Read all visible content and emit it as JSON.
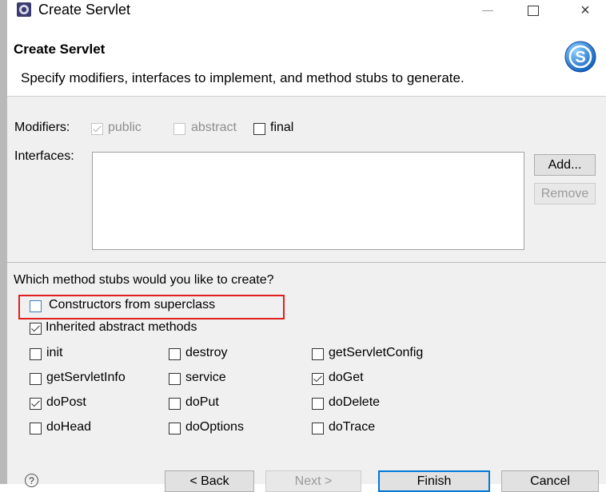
{
  "window": {
    "title": "Create Servlet",
    "close_glyph": "×"
  },
  "header": {
    "title": "Create Servlet",
    "description": "Specify modifiers, interfaces to implement, and method stubs to generate.",
    "logo_letter": "S"
  },
  "modifiers": {
    "label": "Modifiers:",
    "public": {
      "label": "public",
      "checked": true,
      "enabled": false
    },
    "abstract": {
      "label": "abstract",
      "checked": false,
      "enabled": false
    },
    "final": {
      "label": "final",
      "checked": false,
      "enabled": true
    }
  },
  "interfaces": {
    "label": "Interfaces:",
    "add_label": "Add...",
    "remove_label": "Remove"
  },
  "stubs": {
    "question": "Which method stubs would you like to create?",
    "constructors": {
      "label": "Constructors from superclass",
      "checked": false
    },
    "inherited": {
      "label": "Inherited abstract methods",
      "checked": true
    },
    "methods": [
      {
        "label": "init",
        "checked": false
      },
      {
        "label": "destroy",
        "checked": false
      },
      {
        "label": "getServletConfig",
        "checked": false
      },
      {
        "label": "getServletInfo",
        "checked": false
      },
      {
        "label": "service",
        "checked": false
      },
      {
        "label": "doGet",
        "checked": true
      },
      {
        "label": "doPost",
        "checked": true
      },
      {
        "label": "doPut",
        "checked": false
      },
      {
        "label": "doDelete",
        "checked": false
      },
      {
        "label": "doHead",
        "checked": false
      },
      {
        "label": "doOptions",
        "checked": false
      },
      {
        "label": "doTrace",
        "checked": false
      }
    ]
  },
  "footer": {
    "help_glyph": "?",
    "back_label": "< Back",
    "next_label": "Next >",
    "finish_label": "Finish",
    "cancel_label": "Cancel"
  },
  "colors": {
    "highlight": "#e02020",
    "default_button_border": "#0078d7",
    "logo": "#1e88e5"
  }
}
